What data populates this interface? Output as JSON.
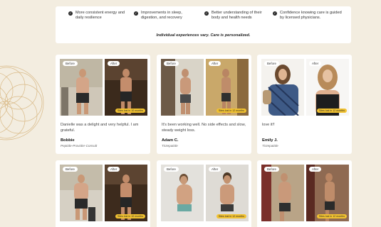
{
  "benefits": [
    "More consistent energy and daily resilience",
    "Improvements in sleep, digestion, and recovery",
    "Better understanding of their body and health needs",
    "Confidence knowing care is guided by licensed physicians."
  ],
  "disclaimer": "Individual experiences vary. Care is personalized.",
  "labels": {
    "before": "Before",
    "after": "After"
  },
  "testimonials": [
    {
      "quote": "Danielle was a delight and very helpful. I am grateful.",
      "name": "Bobbie",
      "role": "Peptide-Provider-Consult",
      "pill": "Sites lost in 10 months"
    },
    {
      "quote": "It's been working well. No side effects and slow, steady weight loss.",
      "name": "Adam C.",
      "role": "Tirzepatide",
      "pill": "Sites lost in 12 months"
    },
    {
      "quote": "love it!!",
      "name": "Emily J.",
      "role": "Tirzepatide",
      "pill": "Sites lost in 12 months"
    },
    {
      "quote": "",
      "name": "",
      "role": "",
      "pill": "Sites lost in 10 months"
    },
    {
      "quote": "",
      "name": "",
      "role": "",
      "pill": "Sites lost in 12 months"
    },
    {
      "quote": "",
      "name": "",
      "role": "",
      "pill": "Sites lost in 12 months"
    }
  ],
  "colors": {
    "page_bg": "#f3ede0",
    "card_bg": "#ffffff",
    "accent": "#f2c230",
    "deco": "#d9b986"
  }
}
